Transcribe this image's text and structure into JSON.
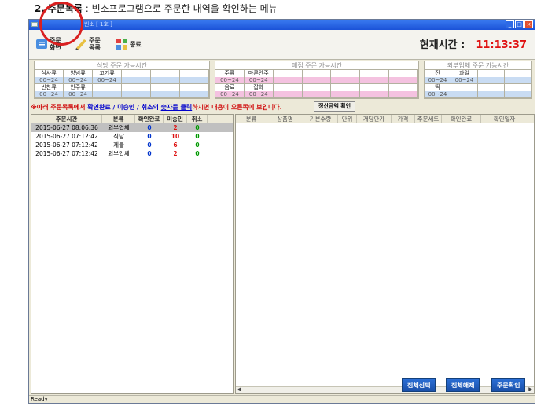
{
  "caption": {
    "number": "2.",
    "title": "주문목록",
    "sep": " : ",
    "desc": "빈소프로그램으로 주문한 내역을 확인하는 메뉴"
  },
  "window": {
    "title": "빈소 [ 1호 ]"
  },
  "toolbar": {
    "items": [
      {
        "label": "주문\n화면",
        "icon": "order-screen-icon",
        "color": "#4a8ee0"
      },
      {
        "label": "주문\n목록",
        "icon": "order-list-icon",
        "color": "#e8c040"
      },
      {
        "label": "종료",
        "icon": "exit-icon",
        "color": "#48b048"
      }
    ],
    "highlight_color": "#d92020"
  },
  "clock": {
    "label": "현재시간 :",
    "time": "11:13:37",
    "color": "#e01010"
  },
  "availability": [
    {
      "group": "식당 주문 가능시간",
      "tint": "#c9dcf3",
      "rows": [
        {
          "names": [
            "식사류",
            "양념류",
            "고기류",
            "",
            "",
            ""
          ],
          "times": [
            "00~24",
            "00~24",
            "00~24",
            "",
            "",
            ""
          ]
        },
        {
          "names": [
            "반찬류",
            "안주류",
            "",
            "",
            "",
            ""
          ],
          "times": [
            "00~24",
            "00~24",
            "",
            "",
            "",
            ""
          ]
        }
      ]
    },
    {
      "group": "매점 주문 가능시간",
      "tint": "#f4c2e0",
      "rows": [
        {
          "names": [
            "주류",
            "마른안주",
            "",
            "",
            "",
            "",
            ""
          ],
          "times": [
            "00~24",
            "00~24",
            "",
            "",
            "",
            "",
            ""
          ]
        },
        {
          "names": [
            "음료",
            "잡화",
            "",
            "",
            "",
            "",
            ""
          ],
          "times": [
            "00~24",
            "00~24",
            "",
            "",
            "",
            "",
            ""
          ]
        }
      ]
    },
    {
      "group": "외부업체 주문 가능시간",
      "tint": "#c9dcf3",
      "rows": [
        {
          "names": [
            "전",
            "과일",
            "",
            ""
          ],
          "times": [
            "00~24",
            "00~24",
            "",
            ""
          ]
        },
        {
          "names": [
            "떡",
            "",
            "",
            ""
          ],
          "times": [
            "00~24",
            "",
            "",
            ""
          ]
        }
      ]
    }
  ],
  "notice": {
    "prefix": "※아래 주문목록에서 ",
    "part2": "확인완료 / 미승인 / 취소의 ",
    "link": "숫자를 클릭",
    "suffix": "하시면 내용이 오른쪽에 보입니다."
  },
  "confirm_amount_button": "정산금액 확인",
  "orders": {
    "headers": [
      "주문시간",
      "분류",
      "확인완료",
      "미승인",
      "취소"
    ],
    "rows": [
      {
        "time": "2015-06-27 08:06:36",
        "category": "외부업체",
        "confirmed": "0",
        "unapproved": "2",
        "cancelled": "0",
        "selected": true
      },
      {
        "time": "2015-06-27 07:12:42",
        "category": "식당",
        "confirmed": "0",
        "unapproved": "10",
        "cancelled": "0",
        "selected": false
      },
      {
        "time": "2015-06-27 07:12:42",
        "category": "제물",
        "confirmed": "0",
        "unapproved": "6",
        "cancelled": "0",
        "selected": false
      },
      {
        "time": "2015-06-27 07:12:42",
        "category": "외부업체",
        "confirmed": "0",
        "unapproved": "2",
        "cancelled": "0",
        "selected": false
      }
    ]
  },
  "detail": {
    "headers": [
      "분류",
      "상품명",
      "기본수량",
      "단위",
      "개당단가",
      "가격",
      "주문세트",
      "확인완료",
      "확인일자"
    ]
  },
  "actions": {
    "select_all": "전체선택",
    "deselect_all": "전체해제",
    "confirm_order": "주문확인"
  },
  "status": {
    "text": "Ready"
  }
}
